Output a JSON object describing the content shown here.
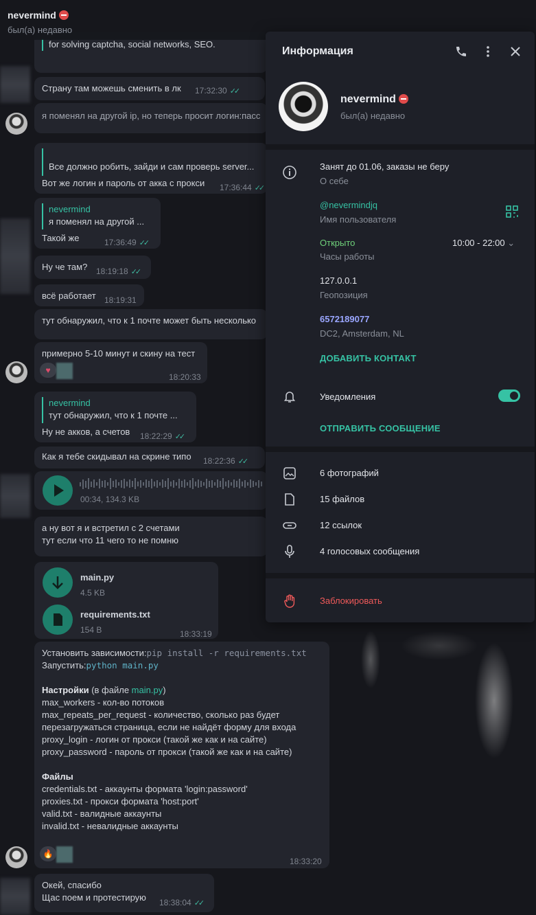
{
  "chat": {
    "title": "nevermind",
    "status": "был(а) недавно"
  },
  "messages": {
    "m1": {
      "text": "for solving captcha, social networks, SEO."
    },
    "m2": {
      "text": "Страну там можешь сменить в лк",
      "time": "17:32:30"
    },
    "m3": {
      "text": "я поменял на другой ip, но теперь просит логин:пасс"
    },
    "m4": {
      "quote": "Все должно робить, зайди и сам проверь server...",
      "text": "Вот же логин и пароль от акка с прокси",
      "time": "17:36:44"
    },
    "m5": {
      "quote_name": "nevermind",
      "quote": "я поменял на другой ...",
      "text": "Такой же",
      "time": "17:36:49"
    },
    "m6": {
      "text": "Ну че там?",
      "time": "18:19:18"
    },
    "m7": {
      "text": "всё работает",
      "time": "18:19:31"
    },
    "m8": {
      "text": "тут обнаружил, что к 1 почте может быть несколько"
    },
    "m9": {
      "text": "примерно 5-10 минут и скину на тест",
      "time": "18:20:33",
      "reaction": "♥"
    },
    "m10": {
      "quote_name": "nevermind",
      "quote": "тут обнаружил, что к 1 почте ...",
      "text": "Ну не акков, а счетов",
      "time": "18:22:29"
    },
    "m11": {
      "text": "Как я тебе скидывал на скрине типо",
      "time": "18:22:36"
    },
    "voice": {
      "meta": "00:34, 134.3 KB"
    },
    "m12": {
      "line1": "а ну вот я и встретил с 2 счетами",
      "line2": "тут если что 11 чего то не помню"
    },
    "files": {
      "f1_name": "main.py",
      "f1_size": "4.5 KB",
      "f2_name": "requirements.txt",
      "f2_size": "154 B",
      "time": "18:33:19"
    },
    "readme": {
      "install_label": "Установить зависимости:",
      "install_cmd": "pip install -r requirements.txt",
      "run_label": "Запустить:",
      "run_cmd": "python main.py",
      "settings_title": "Настройки",
      "settings_note_pre": " (в файле ",
      "settings_file": "main.py",
      "settings_note_post": ")",
      "s1": "max_workers - кол-во потоков",
      "s2": "max_repeats_per_request - количество, сколько раз будет",
      "s3": "перезагружаться страница, если не найдёт форму для входа",
      "s4": "proxy_login - логин от прокси (такой же как и на сайте)",
      "s5": "proxy_password - пароль от прокси (такой же как и на сайте)",
      "files_title": "Файлы",
      "f1": "credentials.txt - аккаунты формата 'login:password'",
      "f2": "proxies.txt - прокси формата 'host:port'",
      "f3": "valid.txt - валидные аккаунты",
      "f4": "invalid.txt - невалидные аккаунты",
      "time": "18:33:20",
      "reaction": "🔥"
    },
    "m13": {
      "line1": "Окей, спасибо",
      "line2": "Щас поем и протестирую",
      "time": "18:38:04"
    }
  },
  "panel": {
    "title": "Информация",
    "name": "nevermind",
    "seen": "был(а) недавно",
    "bio": "Занят до 01.06, заказы не беру",
    "bio_label": "О себе",
    "username": "@nevermindjq",
    "username_label": "Имя пользователя",
    "hours_status": "Открыто",
    "hours_range": "10:00 - 22:00",
    "hours_label": "Часы работы",
    "geo": "127.0.0.1",
    "geo_label": "Геопозиция",
    "phone": "6572189077",
    "phone_sub": "DC2, Amsterdam, NL",
    "add_contact": "ДОБАВИТЬ КОНТАКТ",
    "notifications": "Уведомления",
    "send_message": "ОТПРАВИТЬ СООБЩЕНИЕ",
    "photos": "6 фотографий",
    "files": "15 файлов",
    "links": "12 ссылок",
    "voice": "4 голосовых сообщения",
    "block": "Заблокировать"
  }
}
